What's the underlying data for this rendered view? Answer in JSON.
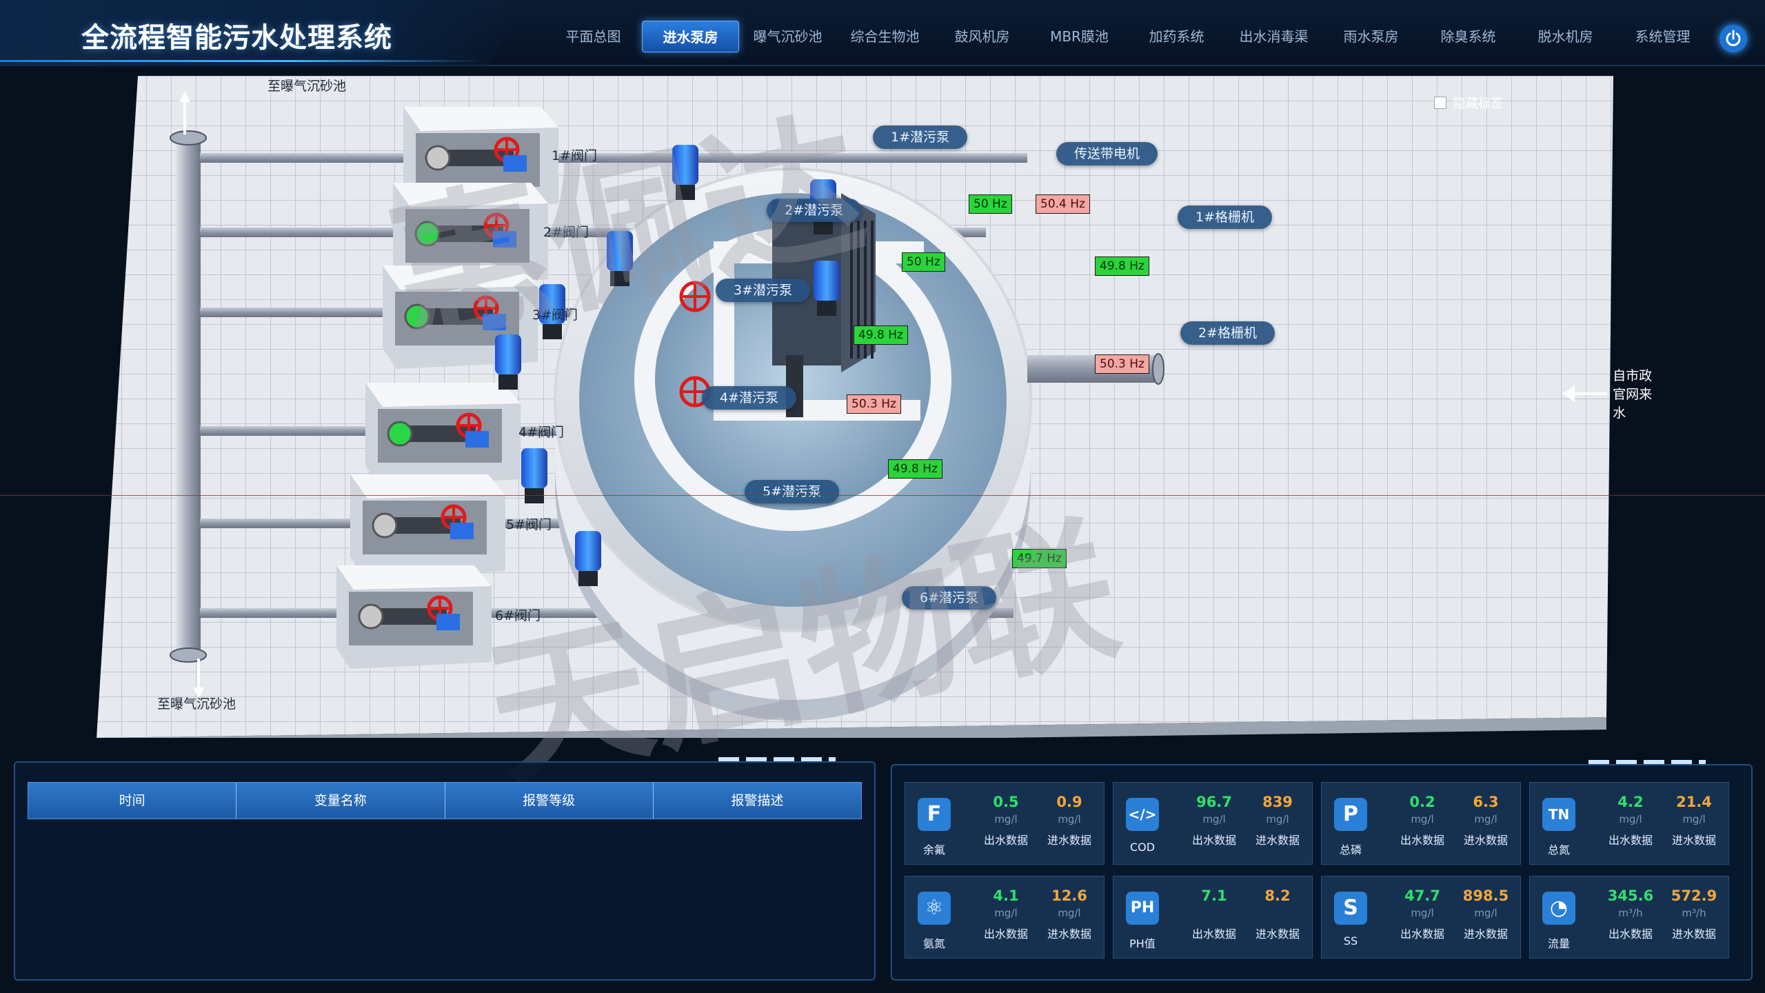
{
  "header": {
    "app_title": "全流程智能污水处理系统",
    "nav": [
      "平面总图",
      "进水泵房",
      "曝气沉砂池",
      "综合生物池",
      "鼓风机房",
      "MBR膜池",
      "加药系统",
      "出水消毒渠",
      "雨水泵房",
      "除臭系统",
      "脱水机房",
      "系统管理"
    ],
    "active_nav": "进水泵房",
    "power_icon": "power-icon"
  },
  "scene": {
    "outlet_top_label": "至曝气沉砂池",
    "outlet_bottom_label": "至曝气沉砂池",
    "inflow_label": "自市政官网来水",
    "hide_labels": "隐藏标签",
    "valves": [
      "1#阀门",
      "2#阀门",
      "3#阀门",
      "4#阀门",
      "5#阀门",
      "6#阀门"
    ],
    "pumps": [
      "1#潜污泵",
      "2#潜污泵",
      "3#潜污泵",
      "4#潜污泵",
      "5#潜污泵",
      "6#潜污泵"
    ],
    "grids": [
      "1#格栅机",
      "2#格栅机"
    ],
    "conveyor": "传送带电机",
    "hz": {
      "p1": "50 Hz",
      "p1b": "50.4 Hz",
      "p2": "50 Hz",
      "p3": "49.8 Hz",
      "p4": "50.3 Hz",
      "p5": "49.8 Hz",
      "p6": "49.7 Hz",
      "g1": "49.8 Hz",
      "g2": "50.3 Hz"
    },
    "valve_indicator_colors": [
      "#c8c8c8",
      "#2bd646",
      "#2bd646",
      "#2bd646",
      "#c8c8c8",
      "#c8c8c8"
    ],
    "watermarks": [
      "惠佩达",
      "天启物联"
    ]
  },
  "alarm_table": {
    "columns": [
      "时间",
      "变量名称",
      "报警等级",
      "报警描述"
    ],
    "rows": []
  },
  "metrics": [
    {
      "icon": "F",
      "icon_name": "fluorine-icon",
      "name": "余氟",
      "out": "0.5",
      "in": "0.9",
      "unit_out": "mg/l",
      "unit_in": "mg/l",
      "out_label": "出水数据",
      "in_label": "进水数据"
    },
    {
      "icon": "</>",
      "icon_name": "cod-icon",
      "name": "COD",
      "out": "96.7",
      "in": "839",
      "unit_out": "mg/l",
      "unit_in": "mg/l",
      "out_label": "出水数据",
      "in_label": "进水数据"
    },
    {
      "icon": "P",
      "icon_name": "phosphorus-icon",
      "name": "总磷",
      "out": "0.2",
      "in": "6.3",
      "unit_out": "mg/l",
      "unit_in": "mg/l",
      "out_label": "出水数据",
      "in_label": "进水数据"
    },
    {
      "icon": "TN",
      "icon_name": "nitrogen-icon",
      "name": "总氮",
      "out": "4.2",
      "in": "21.4",
      "unit_out": "mg/l",
      "unit_in": "mg/l",
      "out_label": "出水数据",
      "in_label": "进水数据"
    },
    {
      "icon": "⚛",
      "icon_name": "ammonia-icon",
      "name": "氨氮",
      "out": "4.1",
      "in": "12.6",
      "unit_out": "mg/l",
      "unit_in": "mg/l",
      "out_label": "出水数据",
      "in_label": "进水数据"
    },
    {
      "icon": "PH",
      "icon_name": "ph-icon",
      "name": "PH值",
      "out": "7.1",
      "in": "8.2",
      "unit_out": "",
      "unit_in": "",
      "out_label": "出水数据",
      "in_label": "进水数据"
    },
    {
      "icon": "S",
      "icon_name": "ss-icon",
      "name": "SS",
      "out": "47.7",
      "in": "898.5",
      "unit_out": "mg/l",
      "unit_in": "mg/l",
      "out_label": "出水数据",
      "in_label": "进水数据"
    },
    {
      "icon": "◔",
      "icon_name": "flow-icon",
      "name": "流量",
      "out": "345.6",
      "in": "572.9",
      "unit_out": "m³/h",
      "unit_in": "m³/h",
      "out_label": "出水数据",
      "in_label": "进水数据"
    }
  ]
}
